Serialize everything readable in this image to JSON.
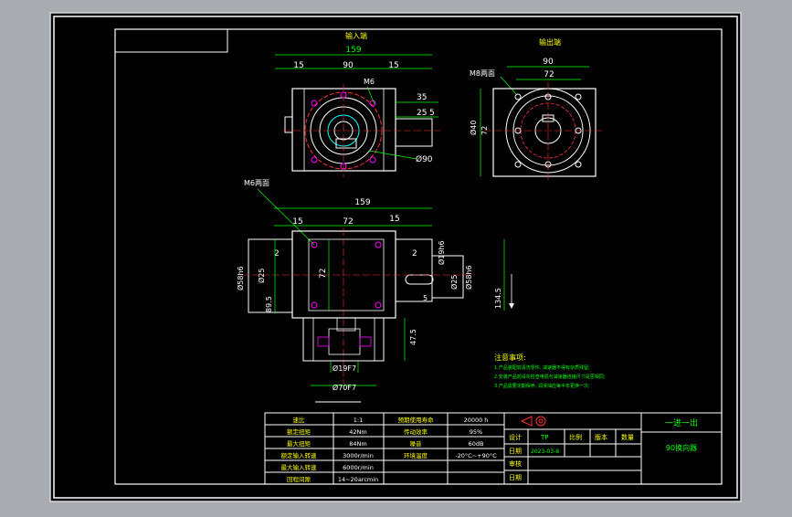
{
  "views": {
    "top_left_title": "输入端",
    "top_right_title": "输出端",
    "dims_top": [
      "159",
      "15",
      "90",
      "15",
      "M6",
      "35",
      "25",
      "5",
      "Ø90"
    ],
    "dims_right": [
      "90",
      "72",
      "M8两面",
      "Ø40",
      "72"
    ],
    "dims_front": [
      "M6两面",
      "159",
      "15",
      "72",
      "15",
      "2",
      "2",
      "72",
      "Ø58h6",
      "Ø25",
      "Ø19h6",
      "Ø25",
      "Ø58h6",
      "89.5",
      "134.5",
      "5",
      "47.5",
      "Ø19F7",
      "Ø70F7"
    ]
  },
  "notes": {
    "title": "注意事项:",
    "lines": [
      "1.产品装配前清洗零件, 减速器不得有杂质残留;",
      "2.安装产品前请先检查电机与减速器连接尺寸是否相同;",
      "3.产品需要定期保养, 润滑油应每半年更换一次;"
    ]
  },
  "specs": {
    "rows": [
      [
        "速比",
        "1:1",
        "预期使用寿命",
        "20000 h"
      ],
      [
        "额定扭矩",
        "42Nm",
        "传动效率",
        "95%"
      ],
      [
        "最大扭矩",
        "84Nm",
        "噪音",
        "60dB"
      ],
      [
        "额定输入转速",
        "3000r/min",
        "环境温度",
        "-20°C~+90°C"
      ],
      [
        "最大输入转速",
        "6000r/min",
        "",
        ""
      ],
      [
        "回程间隙",
        "14~20arcmin",
        "",
        ""
      ]
    ]
  },
  "title_block": {
    "label_design": "设计",
    "design_value": "TP",
    "label_ratio": "比例",
    "label_version": "版本",
    "label_weight": "数量",
    "label_date": "日期",
    "date_value": "2023-03-8",
    "label_review": "审核",
    "label_date2": "日期",
    "project": "一进一出",
    "drawing_name": "90换向器"
  }
}
